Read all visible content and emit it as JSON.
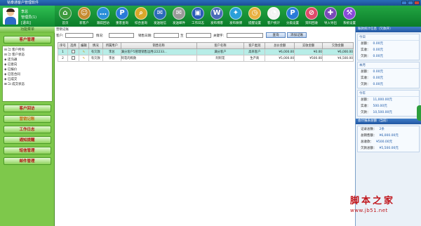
{
  "window": {
    "title": "铭泰通客户管理软件"
  },
  "user": {
    "name": "李总",
    "role": "管理员(1)",
    "logout": "[退出]"
  },
  "toolbar": [
    {
      "icon": "home-icon",
      "glyph": "⌂",
      "label": "首页",
      "color": "#3c9a3c"
    },
    {
      "icon": "add-customer-icon",
      "glyph": "☺",
      "label": "新客户",
      "color": "#c58a2e"
    },
    {
      "icon": "chat-icon",
      "glyph": "…",
      "label": "跟踪回访",
      "color": "#2a8fd9"
    },
    {
      "icon": "query-icon",
      "glyph": "P",
      "label": "重客查询",
      "color": "#2a7ad9"
    },
    {
      "icon": "search-icon",
      "glyph": "⌕",
      "label": "综合查询",
      "color": "#d9a82a"
    },
    {
      "icon": "sms-icon",
      "glyph": "✉",
      "label": "发送短信",
      "color": "#2a6ab8"
    },
    {
      "icon": "mail-icon",
      "glyph": "✉",
      "label": "发送邮件",
      "color": "#999999"
    },
    {
      "icon": "monitor-icon",
      "glyph": "▣",
      "label": "工作日志",
      "color": "#2a5ab8"
    },
    {
      "icon": "wordpress-icon",
      "glyph": "W",
      "label": "发布博客",
      "color": "#4a6ab8"
    },
    {
      "icon": "twitter-icon",
      "glyph": "✦",
      "label": "发布微博",
      "color": "#2aa0d9"
    },
    {
      "icon": "clock-icon",
      "glyph": "◷",
      "label": "提醒设置",
      "color": "#e8b040"
    },
    {
      "icon": "chart-icon",
      "glyph": "◔",
      "label": "客户统计",
      "color": "#f2f2f2"
    },
    {
      "icon": "settings-icon",
      "glyph": "P",
      "label": "分类设置",
      "color": "#2a7ad9"
    },
    {
      "icon": "block-icon",
      "glyph": "⊘",
      "label": "资料回收",
      "color": "#e24a6a"
    },
    {
      "icon": "import-icon",
      "glyph": "✚",
      "label": "导入导出",
      "color": "#7a4ab8"
    },
    {
      "icon": "tools-icon",
      "glyph": "⚒",
      "label": "系统设置",
      "color": "#8a4ad9"
    }
  ],
  "sidebar": {
    "header": "功能菜单",
    "buttons": [
      "客户管理",
      "客户回访",
      "营销记账",
      "工作日志",
      "通知提醒",
      "短信管理",
      "邮件管理"
    ],
    "tree": [
      {
        "label": "⊟ 🗀 客户所有"
      },
      {
        "label": "⊟ 🗀 客户状态"
      },
      {
        "label": "     ◈ 还沟通"
      },
      {
        "label": "     ◈ 已意向"
      },
      {
        "label": "     ◈ 已报价"
      },
      {
        "label": "     ◈ 已签合同"
      },
      {
        "label": "     ◈ 已成交"
      },
      {
        "label": "⊞ 🗀 成交状态"
      }
    ]
  },
  "filter": {
    "section_title": "营销记账",
    "customer_label": "客户:",
    "status_label": "情况:",
    "date_label": "销售日期:",
    "to_label": "至",
    "keyword_label": "关键字:",
    "query_button": "查询",
    "add_button": "添加记账"
  },
  "table": {
    "headers": [
      "序号",
      "选择",
      "编辑",
      "情况",
      "所属用户",
      "销售名称",
      "客户名称",
      "客户类别",
      "总价金额",
      "实收金额",
      "欠款金额"
    ],
    "rows": [
      [
        "1",
        "",
        "✎",
        "有欠款",
        "李总",
        "满分客户5管理销售运用(22233...",
        "满分客户",
        "高率客户",
        "¥6,000.00",
        "¥0.00",
        "¥6,000.00"
      ],
      [
        "2",
        "",
        "✎",
        "有欠款",
        "李总",
        "阿花的购款",
        "阿阿花",
        "生产商",
        "¥5,000.00",
        "¥500.00",
        "¥4,500.00"
      ]
    ]
  },
  "right_panel": {
    "title": "账款统计信息（欠款开）",
    "sections": [
      {
        "caption": "今日",
        "rows": [
          [
            "总额：",
            "0.00元"
          ],
          [
            "实收：",
            "0.00元"
          ],
          [
            "欠款：",
            "0.00元"
          ]
        ]
      },
      {
        "caption": "本月",
        "rows": [
          [
            "总额：",
            "0.00元"
          ],
          [
            "实收：",
            "0.00元"
          ],
          [
            "欠款：",
            "0.00元"
          ]
        ]
      },
      {
        "caption": "今年",
        "rows": [
          [
            "总额：",
            "11,000.00元"
          ],
          [
            "实收：",
            "500.00元"
          ],
          [
            "欠款：",
            "10,500.00元"
          ]
        ]
      }
    ],
    "title2": "会计报表总额（当前）",
    "summary": [
      [
        "记录总数：",
        "2条"
      ],
      [
        "总销售额：",
        "¥6,000.00元"
      ],
      [
        "总收款：",
        "¥500.00元"
      ],
      [
        "欠款总额：",
        "¥5,500.00元"
      ]
    ]
  },
  "watermark": {
    "big": "脚本之家",
    "small": "www.jb51.net"
  }
}
